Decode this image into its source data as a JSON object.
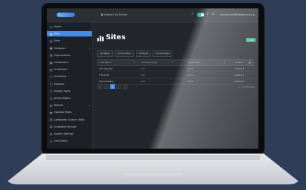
{
  "topbar": {
    "breadcrumb": "System City Florida",
    "user_email": "nancyschool@digitaut.com ▲"
  },
  "sidebar": {
    "items": [
      {
        "icon": "⌂",
        "label": "Home"
      },
      {
        "icon": "▦",
        "label": "Sites"
      },
      {
        "icon": "▤",
        "label": "Roles"
      },
      {
        "icon": "▣",
        "label": "Hardware",
        "chevron": "‹"
      },
      {
        "icon": "▥",
        "label": "Organizations"
      },
      {
        "icon": "▩",
        "label": "Cardholders"
      },
      {
        "icon": "▧",
        "label": "Credentials"
      },
      {
        "icon": "◷",
        "label": "Schedules"
      },
      {
        "icon": "◫",
        "label": "Holidays"
      },
      {
        "icon": "◫",
        "label": "Holiday Types"
      },
      {
        "icon": "⚿",
        "label": "Access Rights"
      },
      {
        "icon": "▤",
        "label": "Reports",
        "chevron": "‹"
      },
      {
        "icon": "◉",
        "label": "Operator Roles"
      },
      {
        "icon": "▨",
        "label": "Cardholder Custom Fields"
      },
      {
        "icon": "▨",
        "label": "Credential Formats"
      },
      {
        "icon": "⚙",
        "label": "System Settings"
      },
      {
        "icon": "✦",
        "label": "Live Events"
      }
    ]
  },
  "main": {
    "title": "Sites",
    "create_label": "Create",
    "tabs": [
      "All Pages",
      "Current Page",
      "All Pages",
      "Current Page"
    ],
    "columns": [
      "Site Name",
      "Hardware Type",
      "Organization",
      "Actions"
    ],
    "rows": [
      {
        "name": "Fire City Site",
        "hardware": "ACC",
        "org": "Alamo",
        "action": "Actions ▾"
      },
      {
        "name": "Florida B",
        "hardware": "ACC",
        "org": "Alamo",
        "action": "Actions ▾"
      },
      {
        "name": "Fire Academy",
        "hardware": "ACC",
        "org": "Alamo",
        "action": "Actions ▾"
      }
    ],
    "pager": [
      "«",
      "‹",
      "1",
      "›",
      "»"
    ],
    "range_text": "1 - 3 of 3 items"
  }
}
